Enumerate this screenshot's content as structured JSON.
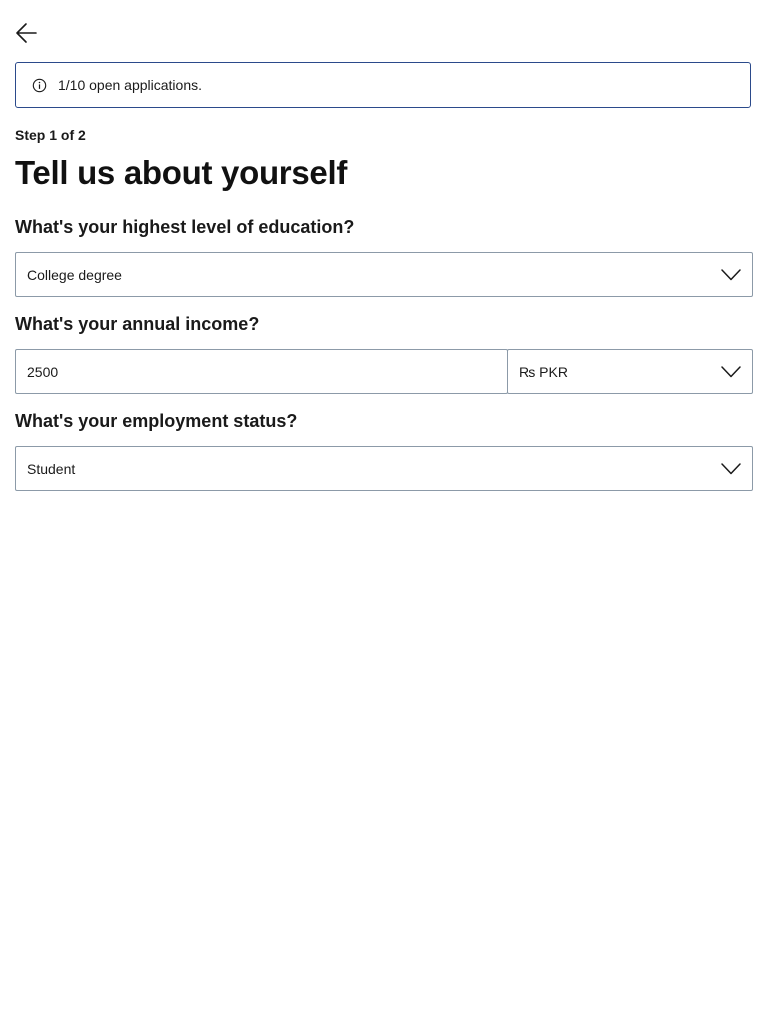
{
  "nav": {
    "back_icon": "arrow-left-icon"
  },
  "banner": {
    "icon": "info-icon",
    "text": "1/10 open applications."
  },
  "form": {
    "step_label": "Step 1 of 2",
    "title": "Tell us about yourself",
    "education": {
      "question": "What's your highest level of education?",
      "selected": "College degree"
    },
    "income": {
      "question": "What's your annual income?",
      "amount_value": "2500",
      "currency_selected": "₨ PKR"
    },
    "employment": {
      "question": "What's your employment status?",
      "selected": "Student"
    }
  },
  "colors": {
    "banner_border": "#2b4a8b",
    "field_border": "#8c9aa8",
    "text": "#1a1a1a"
  }
}
